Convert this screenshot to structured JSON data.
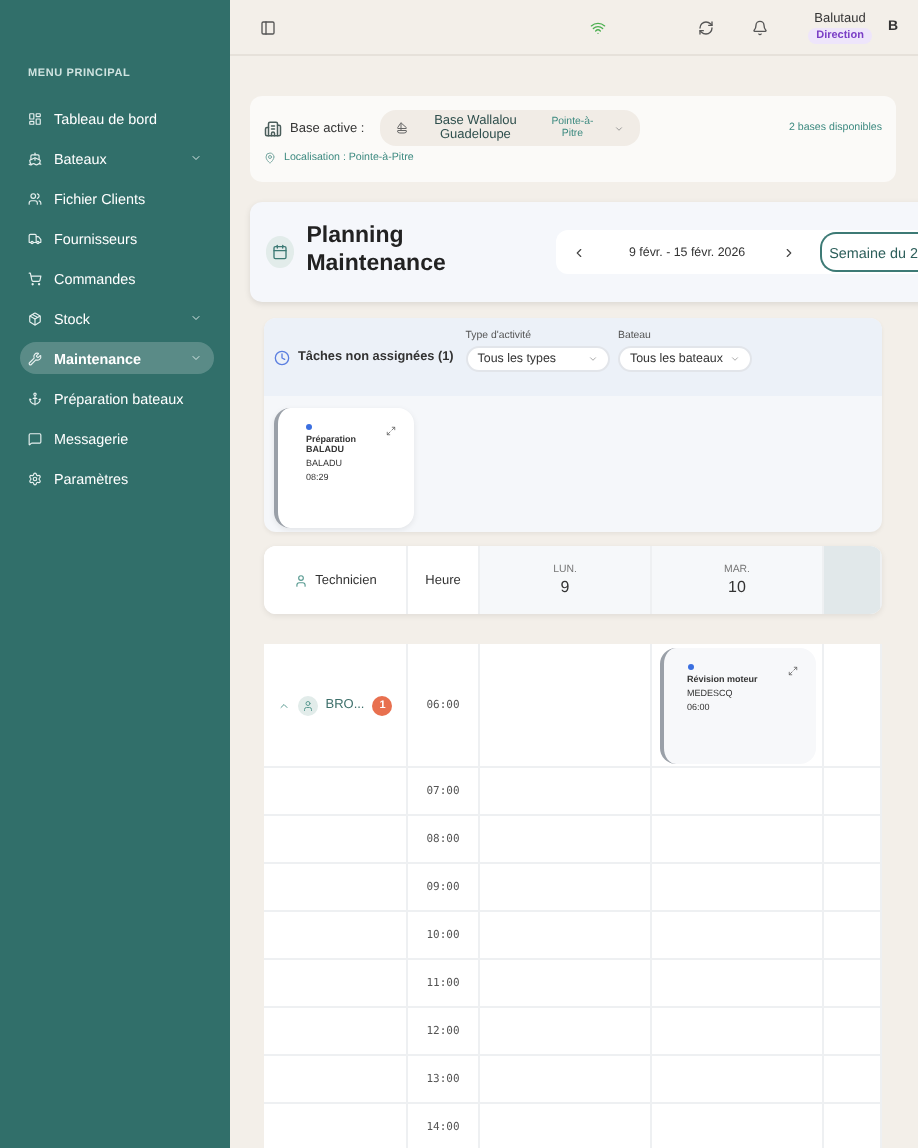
{
  "sidebar": {
    "section_title": "MENU PRINCIPAL",
    "items": [
      {
        "label": "Tableau de bord",
        "expandable": false,
        "selected": false
      },
      {
        "label": "Bateaux",
        "expandable": true,
        "selected": false
      },
      {
        "label": "Fichier Clients",
        "expandable": false,
        "selected": false
      },
      {
        "label": "Fournisseurs",
        "expandable": false,
        "selected": false
      },
      {
        "label": "Commandes",
        "expandable": false,
        "selected": false
      },
      {
        "label": "Stock",
        "expandable": true,
        "selected": false
      },
      {
        "label": "Maintenance",
        "expandable": true,
        "selected": true
      },
      {
        "label": "Préparation bateaux",
        "expandable": false,
        "selected": false
      },
      {
        "label": "Messagerie",
        "expandable": false,
        "selected": false
      },
      {
        "label": "Paramètres",
        "expandable": false,
        "selected": false
      }
    ]
  },
  "topbar": {
    "user_name": "Balutaud",
    "role": "Direction",
    "avatar": "B"
  },
  "base": {
    "label": "Base active :",
    "name": "Base Wallalou Guadeloupe",
    "city": "Pointe-à-Pitre",
    "location": "Localisation : Pointe-à-Pitre",
    "count": "2 bases disponibles"
  },
  "planning": {
    "title": "Planning Maintenance",
    "range": "9 févr. - 15 févr. 2026",
    "week_button": "Semaine du 2"
  },
  "unassigned": {
    "title": "Tâches non assignées (1)",
    "filters": [
      {
        "label": "Type d'activité",
        "value": "Tous les types"
      },
      {
        "label": "Bateau",
        "value": "Tous les bateaux"
      }
    ],
    "tasks": [
      {
        "title": "Préparation BALADU",
        "boat": "BALADU",
        "time": "08:29"
      }
    ]
  },
  "schedule": {
    "technician_header": "Technicien",
    "hour_header": "Heure",
    "days": [
      {
        "dow": "LUN.",
        "num": "9"
      },
      {
        "dow": "MAR.",
        "num": "10",
        "events": [
          {
            "title": "Révision moteur",
            "boat": "MEDESCQ",
            "time": "06:00"
          }
        ]
      }
    ],
    "technician": {
      "name": "BRO...",
      "count": "1",
      "expanded": true
    },
    "first_hour": "06:00",
    "hours": [
      "07:00",
      "08:00",
      "09:00",
      "10:00",
      "11:00",
      "12:00",
      "13:00",
      "14:00"
    ]
  }
}
